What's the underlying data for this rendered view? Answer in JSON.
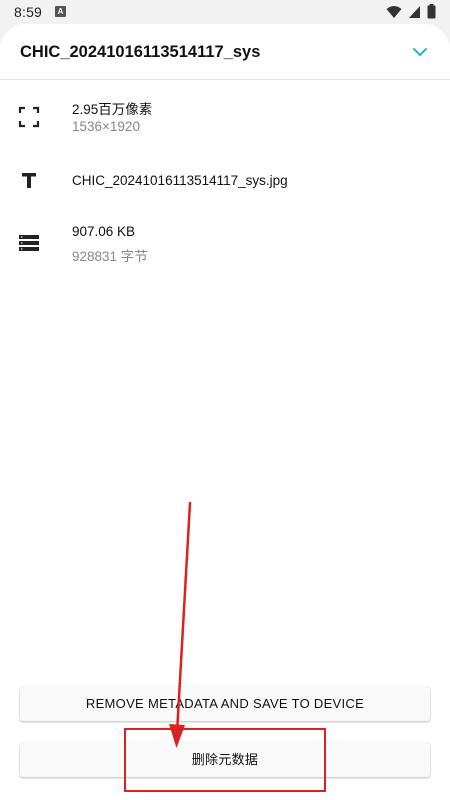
{
  "status_bar": {
    "time": "8:59",
    "badge": "A"
  },
  "header": {
    "title": "CHIC_20241016113514117_sys"
  },
  "info": {
    "resolution": {
      "primary": "2.95百万像素",
      "secondary": "1536×1920"
    },
    "filename": {
      "primary": "CHIC_20241016113514117_sys.jpg"
    },
    "size": {
      "primary": "907.06 KB",
      "secondary": "928831 字节"
    }
  },
  "actions": {
    "remove_save_label": "REMOVE METADATA AND SAVE TO DEVICE",
    "delete_metadata_label": "删除元数据"
  },
  "colors": {
    "accent": "#26b5c8",
    "annotation": "#e02020"
  },
  "icons": {
    "resolution": "crop-frame-icon",
    "filename": "text-t-icon",
    "size": "storage-list-icon",
    "collapse": "chevron-down-icon"
  }
}
